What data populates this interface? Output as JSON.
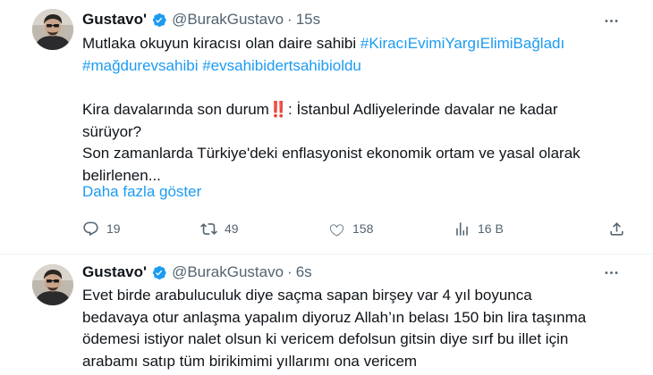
{
  "tweets": [
    {
      "name": "Gustavo'",
      "handle": "@BurakGustavo",
      "separator": "·",
      "time": "15s",
      "lines": [
        {
          "text": "Mutlaka okuyun kiracısı olan daire sahibi ",
          "tag": "#KiracıEvimiYargıElimiBağladı"
        },
        {
          "tag": "#mağdurevsahibi",
          "text": " ",
          "tag2": "#evsahibidertsahibioldu"
        },
        {
          "text": ""
        },
        {
          "text": "Kira davalarında son durum",
          "bang": "‼️",
          "text2": ": İstanbul Adliyelerinde davalar ne kadar"
        },
        {
          "text": "sürüyor?"
        },
        {
          "text": "Son zamanlarda Türkiye'deki enflasyonist ekonomik ortam ve yasal olarak"
        },
        {
          "text": "belirlenen..."
        }
      ],
      "show_more": "Daha fazla göster",
      "metrics": {
        "replies": "19",
        "retweets": "49",
        "likes": "158",
        "views": "16 B"
      }
    },
    {
      "name": "Gustavo'",
      "handle": "@BurakGustavo",
      "separator": "·",
      "time": "6s",
      "lines": [
        {
          "text": "Evet birde arabuluculuk diye saçma sapan birşey var 4 yıl boyunca"
        },
        {
          "text": "bedavaya otur anlaşma yapalım diyoruz Allah’ın belası 150 bin lira taşınma"
        },
        {
          "text": "ödemesi istiyor nalet olsun ki vericem defolsun gitsin diye sırf bu illet için"
        },
        {
          "text": "arabamı satıp tüm birikimimi yıllarımı ona vericem"
        }
      ]
    }
  ],
  "colors": {
    "link": "#1d9bf0",
    "text": "#0f1419",
    "muted": "#536471",
    "verified": "#1d9bf0",
    "alert": "#e0245e"
  },
  "icons": [
    "avatar",
    "verified-badge-icon",
    "more-options-icon",
    "reply-icon",
    "retweet-icon",
    "like-icon",
    "views-icon",
    "bookmark-icon"
  ]
}
